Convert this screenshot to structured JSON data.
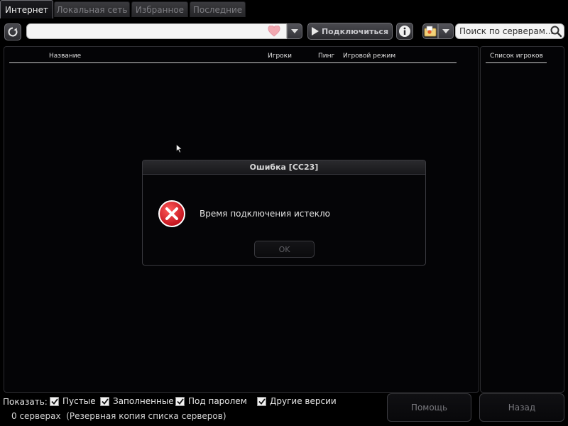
{
  "tabs": [
    {
      "label": "Интернет",
      "active": true
    },
    {
      "label": "Локальная сеть",
      "active": false
    },
    {
      "label": "Избранное",
      "active": false
    },
    {
      "label": "Последние",
      "active": false
    }
  ],
  "toolbar": {
    "address_value": "",
    "connect_label": "Подключиться",
    "search_placeholder": "Поиск по серверам..."
  },
  "server_list": {
    "columns": [
      "Название",
      "Игроки",
      "Пинг",
      "Игровой режим"
    ]
  },
  "player_list": {
    "header": "Список игроков"
  },
  "dialog": {
    "title": "Ошибка [CC23]",
    "message": "Время подключения истекло",
    "ok_label": "OK"
  },
  "filters": {
    "label": "Показать:",
    "items": [
      {
        "label": "Пустые",
        "checked": true
      },
      {
        "label": "Заполненные",
        "checked": true
      },
      {
        "label": "Под паролем",
        "checked": true
      },
      {
        "label": "Другие версии",
        "checked": true
      }
    ]
  },
  "status": {
    "count": "0 серверах",
    "backup": "(Резервная копия списка серверов)"
  },
  "buttons": {
    "help": "Помощь",
    "back": "Назад"
  },
  "colors": {
    "background": "#000000",
    "error_red": "#d81e28",
    "heart_pink": "#f0a8b0"
  }
}
